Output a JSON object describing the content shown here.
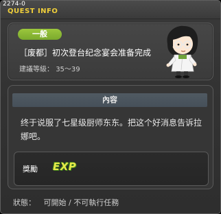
{
  "window": {
    "quest_id": "2274-0",
    "title": "QUEST INFO"
  },
  "quest": {
    "category": "一般",
    "name": "［废都］初次登台纪念宴会准备完成",
    "level_label": "建議等級：",
    "level_range": "35～39"
  },
  "details": {
    "header": "內容",
    "description": "终于说服了七星级厨师东东。把这个好消息告诉拉娜吧。"
  },
  "reward": {
    "label": "獎勵",
    "exp_text": "EXP"
  },
  "status": {
    "label": "狀態：",
    "value": "可開始 / 不可執行任務"
  },
  "colors": {
    "title": "#f0cf3a",
    "pill": "#8fb936",
    "exp": "#e7e84a"
  },
  "icons": {
    "npc": "npc-portrait-icon",
    "exp": "exp-icon"
  }
}
